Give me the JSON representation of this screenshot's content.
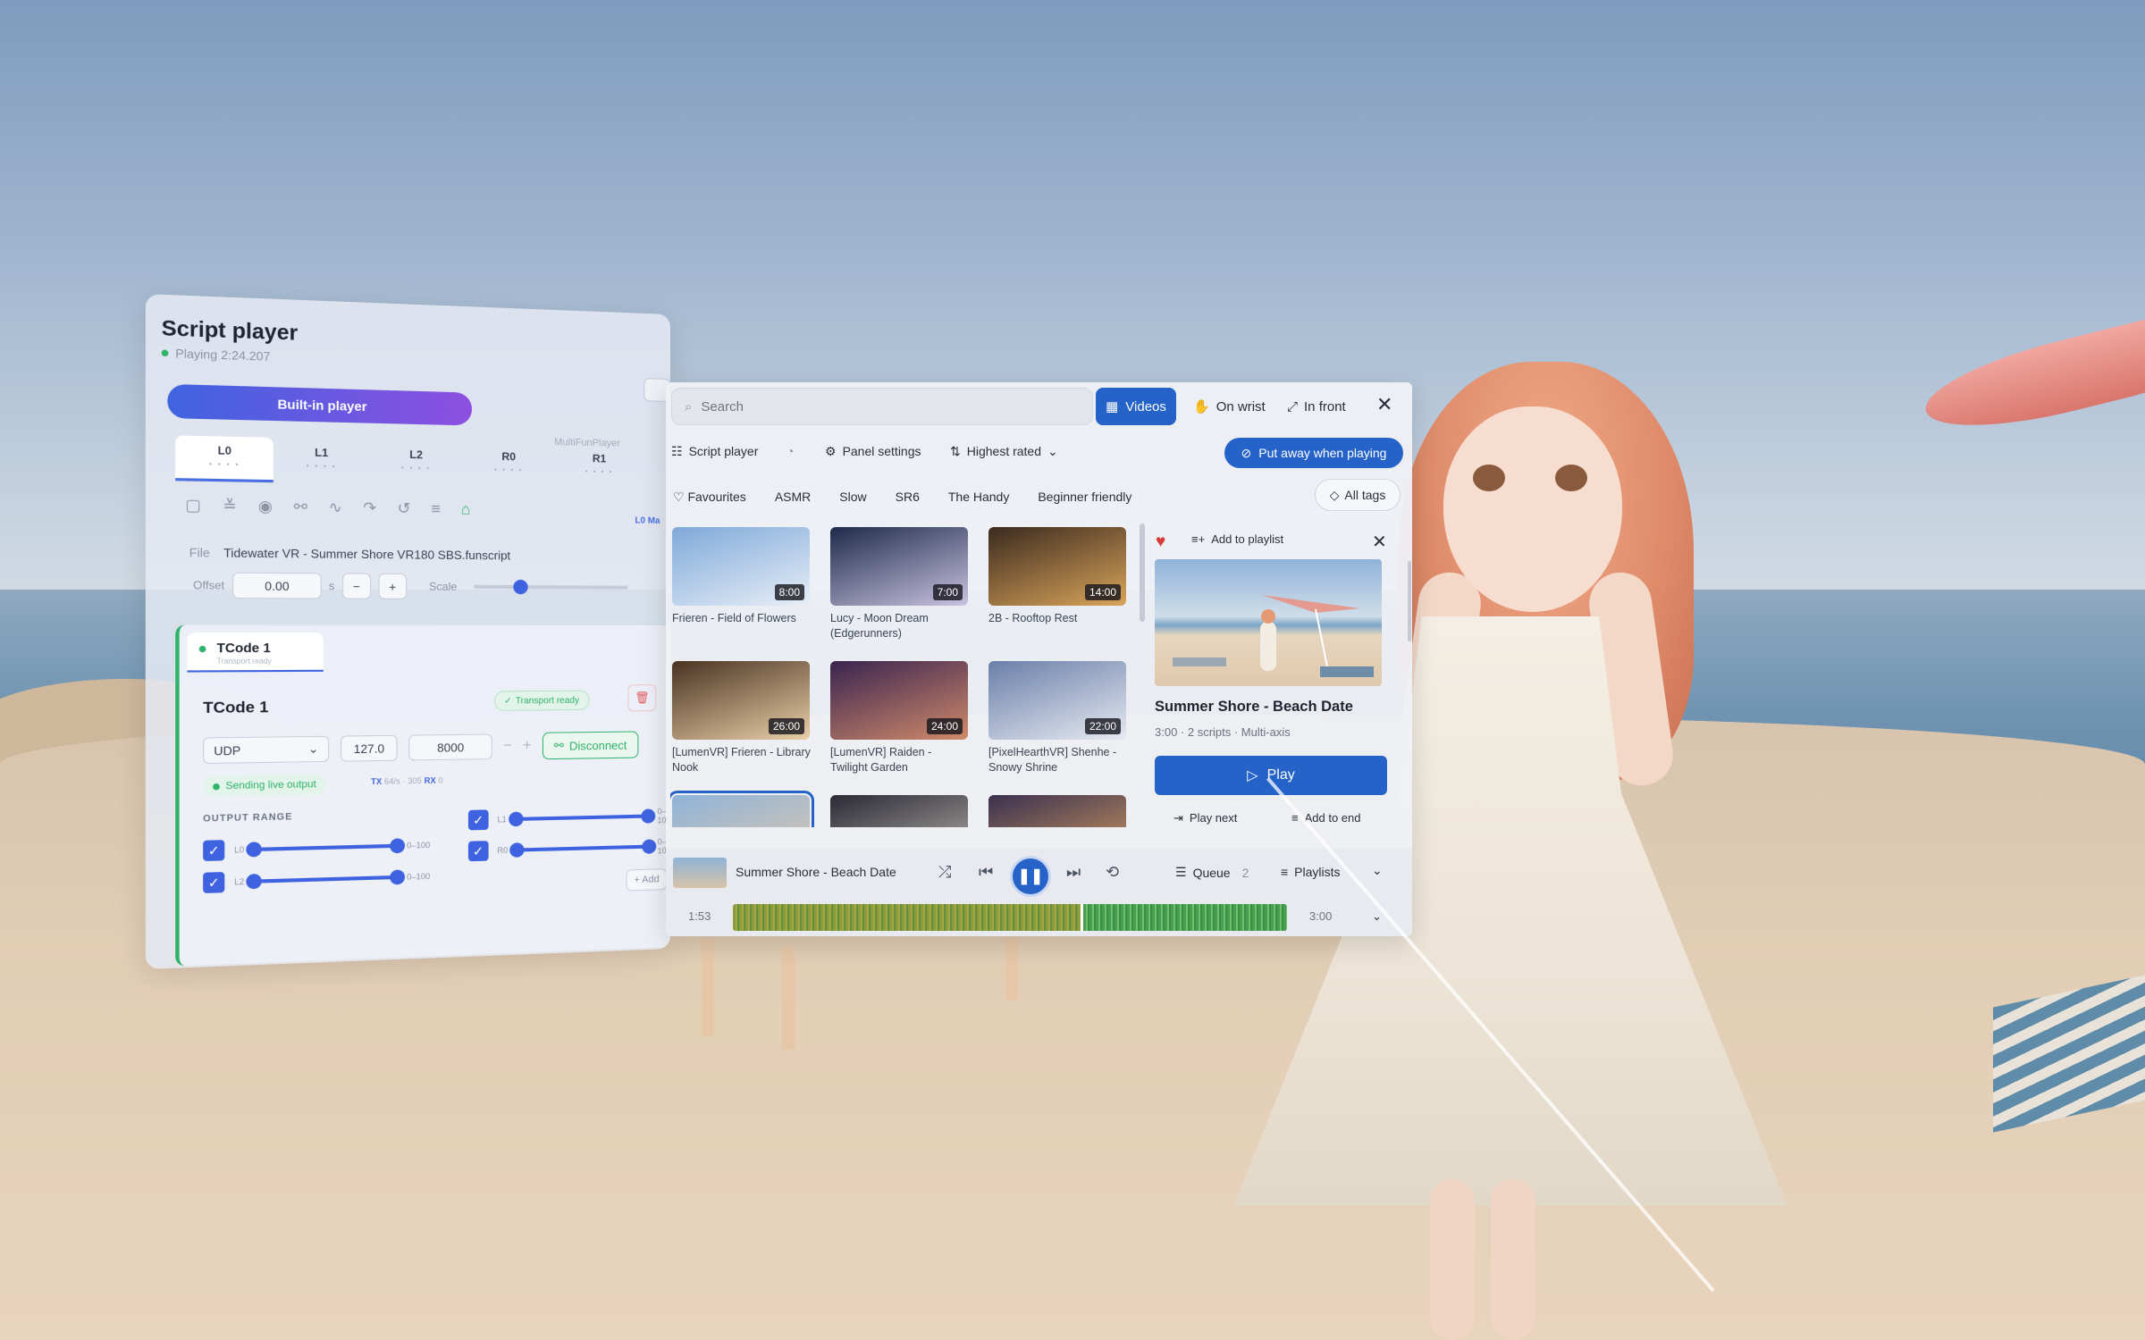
{
  "script_player": {
    "title": "Script player",
    "status": "Playing 2:24.207",
    "mode_active": "Built-in player",
    "mode_other": "MultiFunPlayer",
    "axes": [
      {
        "label": "L0",
        "dots": "• • • •"
      },
      {
        "label": "L1",
        "dots": "• • • •"
      },
      {
        "label": "L2",
        "dots": "• • • •"
      },
      {
        "label": "R0",
        "dots": "• • • •"
      },
      {
        "label": "R1",
        "dots": "• • • •"
      }
    ],
    "active_axis": "L0",
    "axis_tag": "L0 Ma",
    "file_label": "File",
    "file_name": "Tidewater VR - Summer Shore VR180 SBS.funscript",
    "offset_label": "Offset",
    "offset_value": "0.00",
    "offset_unit": "s",
    "scale_label": "Scale",
    "scale_level": 0.3,
    "tcode": {
      "tab_label": "TCode 1",
      "tab_sub": "Transport ready",
      "name": "TCode 1",
      "ready_badge": "Transport ready",
      "protocol": "UDP",
      "host": "127.0",
      "port": "8000",
      "disconnect_label": "Disconnect",
      "live_label": "Sending live output",
      "tx_label": "TX",
      "tx_value": "64/s · 305",
      "rx_label": "RX",
      "rx_value": "0",
      "output_range_label": "OUTPUT RANGE",
      "ranges": [
        {
          "axis": "L0",
          "range": "0–100"
        },
        {
          "axis": "L1",
          "range": "0–100"
        },
        {
          "axis": "L2",
          "range": "0–100"
        },
        {
          "axis": "R0",
          "range": "0–100"
        }
      ],
      "add_label": "+ Add"
    }
  },
  "library": {
    "search_placeholder": "Search",
    "header_buttons": {
      "videos": "Videos",
      "on_wrist": "On wrist",
      "in_front": "In front"
    },
    "toolbar": {
      "script_player": "Script player",
      "panel_settings": "Panel settings",
      "sort": "Highest rated",
      "put_away": "Put away when playing"
    },
    "tags": [
      "Favourites",
      "ASMR",
      "Slow",
      "SR6",
      "The Handy",
      "Beginner friendly"
    ],
    "all_tags": "All tags",
    "videos": [
      {
        "title": "Frieren - Field of Flowers",
        "duration": "8:00",
        "colors": [
          "#7fa9d9",
          "#e7eef7"
        ]
      },
      {
        "title": "Lucy - Moon Dream (Edgerunners)",
        "duration": "7:00",
        "colors": [
          "#1e2a4a",
          "#c9c2e0"
        ]
      },
      {
        "title": "2B - Rooftop Rest",
        "duration": "14:00",
        "colors": [
          "#3b2a1f",
          "#d9a45a"
        ]
      },
      {
        "title": "[LumenVR] Frieren - Library Nook",
        "duration": "26:00",
        "colors": [
          "#4a3222",
          "#e8cfa8"
        ]
      },
      {
        "title": "[LumenVR] Raiden - Twilight Garden",
        "duration": "24:00",
        "colors": [
          "#3a2450",
          "#d08a6a"
        ]
      },
      {
        "title": "[PixelHearthVR] Shenhe - Snowy Shrine",
        "duration": "22:00",
        "colors": [
          "#6a7fa8",
          "#e6e9f2"
        ]
      },
      {
        "title": "",
        "duration": "",
        "colors": [
          "#8fb3d8",
          "#e0c9ad"
        ]
      },
      {
        "title": "",
        "duration": "",
        "colors": [
          "#2a2a36",
          "#bfb8b0"
        ]
      },
      {
        "title": "",
        "duration": "",
        "colors": [
          "#3a3050",
          "#d8a060"
        ]
      }
    ],
    "detail": {
      "add_to_playlist": "Add to playlist",
      "title": "Summer Shore - Beach Date",
      "meta": "3:00 · 2 scripts · Multi-axis",
      "play": "Play",
      "play_next": "Play next",
      "add_to_end": "Add to end"
    },
    "player": {
      "title": "Summer Shore - Beach Date",
      "current_time": "1:53",
      "total_time": "3:00",
      "progress": 0.628,
      "queue_label": "Queue",
      "queue_count": "2",
      "playlists_label": "Playlists"
    }
  },
  "colors": {
    "accent": "#2563c9",
    "success": "#2fb26a",
    "heart": "#d93a3a"
  }
}
